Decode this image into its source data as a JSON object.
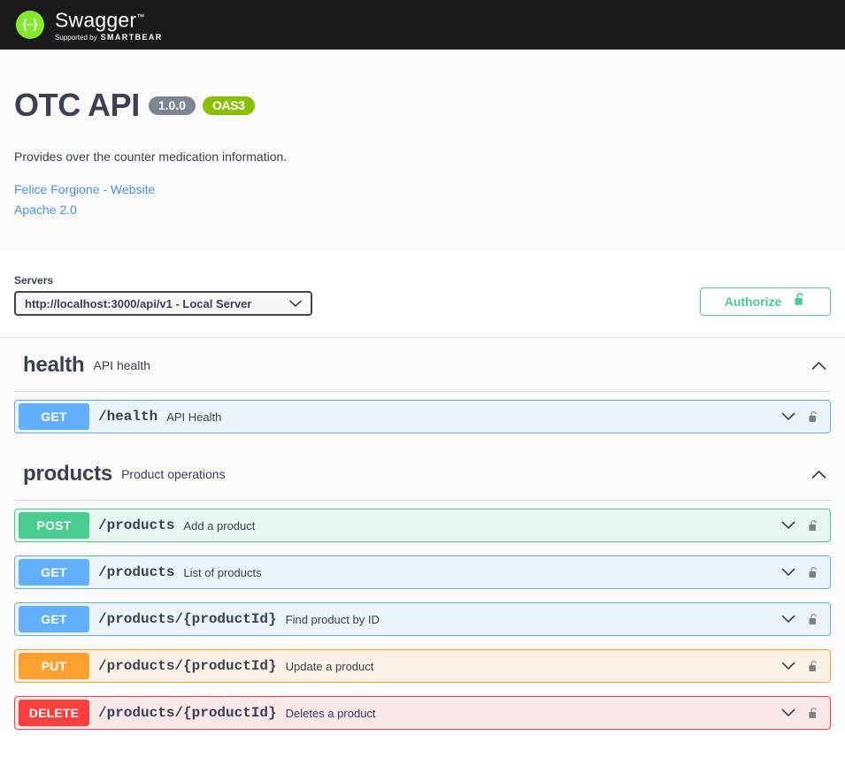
{
  "topbar": {
    "logo_icon": "swagger-braces-icon",
    "brand": "Swagger",
    "trademark": "™",
    "supported_by_prefix": "Supported by",
    "supported_by_brand": "SMARTBEAR"
  },
  "info": {
    "title": "OTC API",
    "version_badge": "1.0.0",
    "spec_badge": "OAS3",
    "description": "Provides over the counter medication information.",
    "links": [
      {
        "label": "Felice Forgione - Website"
      },
      {
        "label": "Apache 2.0"
      }
    ]
  },
  "servers": {
    "label": "Servers",
    "selected": "http://localhost:3000/api/v1 - Local Server",
    "options": [
      "http://localhost:3000/api/v1 - Local Server"
    ]
  },
  "authorize": {
    "label": "Authorize",
    "lock_icon": "unlocked-padlock-icon",
    "state": "unlocked"
  },
  "tags": [
    {
      "name": "health",
      "description": "API health",
      "expanded": true,
      "toggle_icon": "chevron-up-icon",
      "operations": [
        {
          "method": "GET",
          "path": "/health",
          "summary": "API Health",
          "chevron_icon": "chevron-down-icon",
          "lock_icon": "unlocked-padlock-icon"
        }
      ]
    },
    {
      "name": "products",
      "description": "Product operations",
      "expanded": true,
      "toggle_icon": "chevron-up-icon",
      "operations": [
        {
          "method": "POST",
          "path": "/products",
          "summary": "Add a product",
          "chevron_icon": "chevron-down-icon",
          "lock_icon": "unlocked-padlock-icon"
        },
        {
          "method": "GET",
          "path": "/products",
          "summary": "List of products",
          "chevron_icon": "chevron-down-icon",
          "lock_icon": "unlocked-padlock-icon"
        },
        {
          "method": "GET",
          "path": "/products/{productId}",
          "summary": "Find product by ID",
          "chevron_icon": "chevron-down-icon",
          "lock_icon": "unlocked-padlock-icon"
        },
        {
          "method": "PUT",
          "path": "/products/{productId}",
          "summary": "Update a product",
          "chevron_icon": "chevron-down-icon",
          "lock_icon": "unlocked-padlock-icon"
        },
        {
          "method": "DELETE",
          "path": "/products/{productId}",
          "summary": "Deletes a product",
          "chevron_icon": "chevron-down-icon",
          "lock_icon": "unlocked-padlock-icon"
        }
      ]
    }
  ],
  "colors": {
    "topbar_bg": "#1b1b1b",
    "logo_green": "#85ea2d",
    "get": "#61affe",
    "post": "#49cc90",
    "put": "#fca130",
    "delete": "#f93e3e",
    "oas_badge": "#89bf04",
    "version_badge": "#7d8492",
    "link": "#4990e2",
    "text": "#3b4151"
  }
}
